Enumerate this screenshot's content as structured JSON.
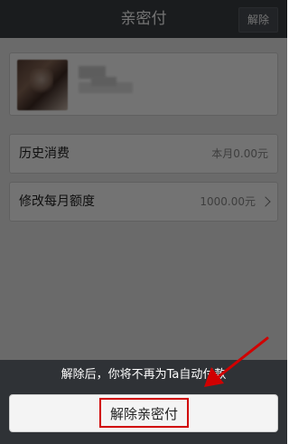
{
  "header": {
    "title": "亲密付",
    "action_label": "解除"
  },
  "profile": {
    "avatar_icon": "blurred-avatar",
    "name_redacted": true
  },
  "rows": {
    "history": {
      "label": "历史消费",
      "value": "本月0.00元"
    },
    "monthly_limit": {
      "label": "修改每月额度",
      "value": "1000.00元",
      "icon": "chevron-right-icon"
    }
  },
  "sheet": {
    "message": "解除后，你将不再为Ta自动付款",
    "button_label": "解除亲密付"
  },
  "colors": {
    "topbar": "#3b3f44",
    "annotation": "#d10000",
    "sheet": "#2f3236"
  }
}
